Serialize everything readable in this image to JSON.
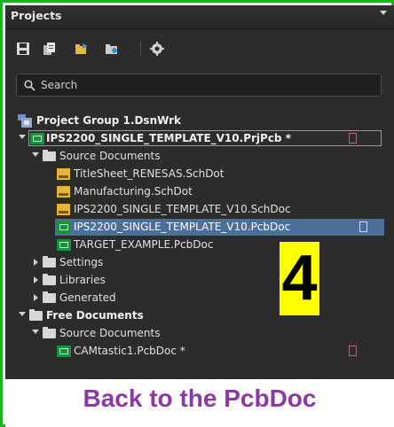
{
  "panel": {
    "title": "Projects"
  },
  "toolbar": {
    "icons": [
      "save-icon",
      "copy-icon",
      "open-icon",
      "folder-icon",
      "gear-icon"
    ]
  },
  "search": {
    "placeholder": "Search"
  },
  "tree": {
    "group": "Project Group 1.DsnWrk",
    "project": "IPS2200_SINGLE_TEMPLATE_V10.PrjPcb *",
    "source_documents": "Source Documents",
    "docs": [
      "TitleSheet_RENESAS.SchDot",
      "Manufacturing.SchDot",
      "IPS2200_SINGLE_TEMPLATE_V10.SchDoc",
      "IPS2200_SINGLE_TEMPLATE_V10.PcbDoc",
      "TARGET_EXAMPLE.PcbDoc"
    ],
    "settings": "Settings",
    "libraries": "Libraries",
    "generated": "Generated",
    "free_documents": "Free Documents",
    "free_source_documents": "Source Documents",
    "free_doc": "CAMtastic1.PcbDoc *"
  },
  "overlay": {
    "step_number": "4",
    "caption": "Back to the PcbDoc"
  },
  "colors": {
    "frame": "#22b022",
    "panel_bg": "#2c2c2c",
    "selection": "#4b6e9a",
    "caption": "#8b3aa0",
    "highlight": "#ffff00"
  }
}
